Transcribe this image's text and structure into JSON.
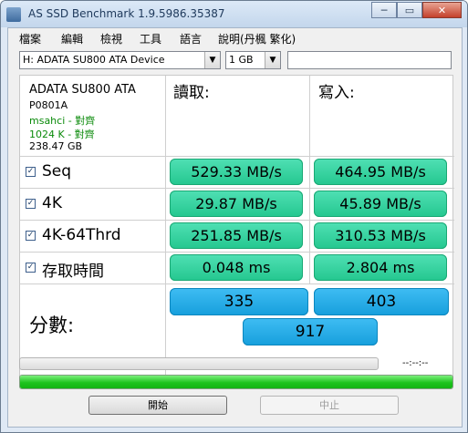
{
  "window": {
    "title": "AS SSD Benchmark 1.9.5986.35387",
    "minimize_label": "─",
    "maximize_label": "▭",
    "close_label": "✕"
  },
  "menu": {
    "items": [
      "檔案",
      "編輯",
      "檢視",
      "工具",
      "語言",
      "說明(丹楓 繁化)"
    ]
  },
  "toolbar": {
    "drive_select": "H: ADATA SU800 ATA Device",
    "size_select": "1 GB",
    "dropdown_arrow": "▼"
  },
  "drive_info": {
    "model": "ADATA SU800 ATA",
    "firmware": "P0801A",
    "driver_status": "msahci - 對齊",
    "alignment_status": "1024 K - 對齊",
    "capacity": "238.47 GB"
  },
  "columns": {
    "read": "讀取:",
    "write": "寫入:"
  },
  "tests": [
    {
      "label": "Seq",
      "checked": "✓",
      "read": "529.33 MB/s",
      "write": "464.95 MB/s"
    },
    {
      "label": "4K",
      "checked": "✓",
      "read": "29.87 MB/s",
      "write": "45.89 MB/s"
    },
    {
      "label": "4K-64Thrd",
      "checked": "✓",
      "read": "251.85 MB/s",
      "write": "310.53 MB/s"
    },
    {
      "label": "存取時間",
      "checked": "✓",
      "read": "0.048 ms",
      "write": "2.804 ms"
    }
  ],
  "score": {
    "label": "分數:",
    "read": "335",
    "write": "403",
    "total": "917"
  },
  "progress": {
    "elapsed_time": "--:--:--",
    "test_progress": 0,
    "overall_progress": 1
  },
  "buttons": {
    "start": "開始",
    "stop": "中止"
  },
  "colors": {
    "result_green": "#24c78f",
    "score_blue": "#169fdc",
    "progress_green": "#1ec41e"
  }
}
